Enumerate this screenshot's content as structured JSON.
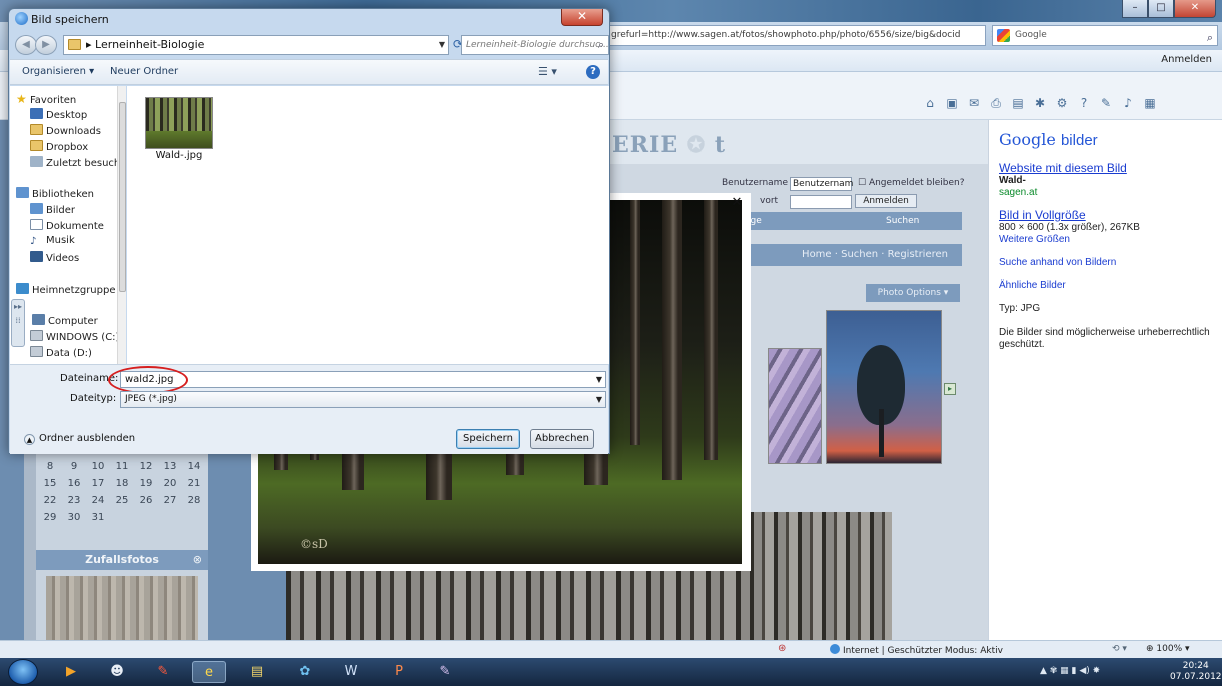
{
  "browser": {
    "url": "grefurl=http://www.sagen.at/fotos/showphoto.php/photo/6556/size/big&docid",
    "search_engine": "Google",
    "signin_label": "Anmelden",
    "status_zone": "Internet | Geschützter Modus: Aktiv",
    "zoom": "100%"
  },
  "site": {
    "logo_main": "ERIE",
    "logo_suffix": "t",
    "username_label": "Benutzername",
    "username_placeholder": "Benutzernam",
    "remember_label": "Angemeldet bleiben?",
    "password_label": "vort",
    "login_button": "Anmelden",
    "nav_left": "ige",
    "nav_search": "Suchen",
    "nav_main": "Home · Suchen · Registrieren",
    "photo_options": "Photo Options ▾",
    "random_photos_title": "Zufallsfotos",
    "photo_credit": "©sD",
    "calendar_rows": [
      [
        "8",
        "9",
        "10",
        "11",
        "12",
        "13",
        "14"
      ],
      [
        "15",
        "16",
        "17",
        "18",
        "19",
        "20",
        "21"
      ],
      [
        "22",
        "23",
        "24",
        "25",
        "26",
        "27",
        "28"
      ],
      [
        "29",
        "30",
        "31"
      ]
    ]
  },
  "google_panel": {
    "logo_word": "Google",
    "logo_sub": "bilder",
    "website_link": "Website mit diesem Bild",
    "page_title": "Wald-",
    "page_domain": "sagen.at",
    "fullsize_link": "Bild in Vollgröße",
    "size_info": "800 × 600 (1.3x größer), 267KB",
    "more_sizes": "Weitere Größen",
    "search_by_image": "Suche anhand von Bildern",
    "similar_images": "Ähnliche Bilder",
    "type_info": "Typ: JPG",
    "copyright_note": "Die Bilder sind möglicherweise urheberrechtlich geschützt."
  },
  "dialog": {
    "title": "Bild speichern",
    "breadcrumb": "Lerneinheit-Biologie",
    "search_placeholder": "Lerneinheit-Biologie durchsuc...",
    "toolbar_organize": "Organisieren ▾",
    "toolbar_new_folder": "Neuer Ordner",
    "nav_items": [
      {
        "label": "Favoriten",
        "icon": "star-icon"
      },
      {
        "label": "Desktop",
        "icon": "desktop-icon"
      },
      {
        "label": "Downloads",
        "icon": "folder-icon"
      },
      {
        "label": "Dropbox",
        "icon": "folder-icon"
      },
      {
        "label": "Zuletzt besucht",
        "icon": "recent-places-icon"
      },
      {
        "label": "Bibliotheken",
        "icon": "library-icon"
      },
      {
        "label": "Bilder",
        "icon": "pictures-icon"
      },
      {
        "label": "Dokumente",
        "icon": "documents-icon"
      },
      {
        "label": "Musik",
        "icon": "music-icon"
      },
      {
        "label": "Videos",
        "icon": "videos-icon"
      },
      {
        "label": "Heimnetzgruppe",
        "icon": "homegroup-icon"
      },
      {
        "label": "Computer",
        "icon": "computer-icon"
      },
      {
        "label": "WINDOWS (C:)",
        "icon": "drive-icon"
      },
      {
        "label": "Data (D:)",
        "icon": "drive-icon"
      }
    ],
    "file_name_shown": "Wald-.jpg",
    "filename_label": "Dateiname:",
    "filename_value": "wald2.jpg",
    "filetype_label": "Dateityp:",
    "filetype_value": "JPEG (*.jpg)",
    "hide_folders": "Ordner ausblenden",
    "save_button": "Speichern",
    "cancel_button": "Abbrechen"
  },
  "taskbar": {
    "time": "20:24",
    "date": "07.07.2012"
  }
}
